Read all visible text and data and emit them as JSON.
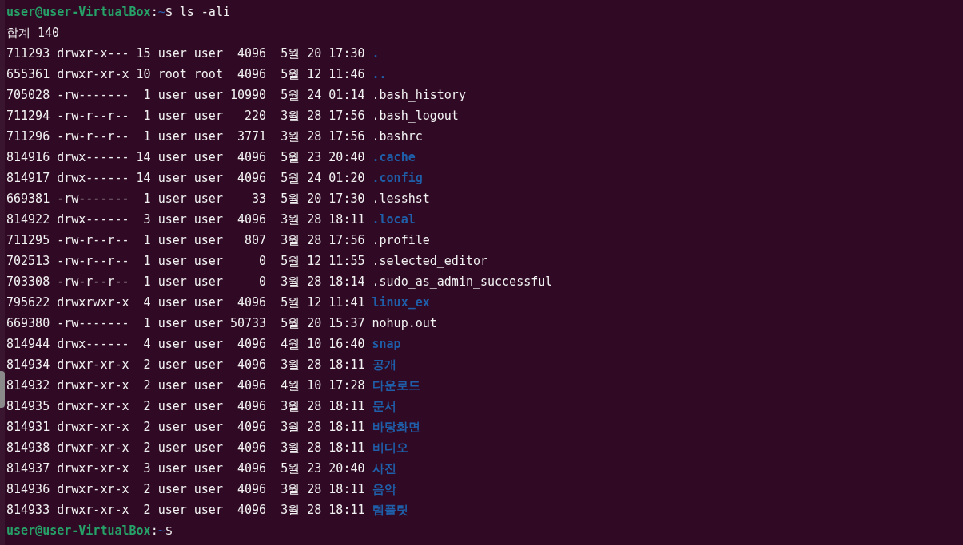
{
  "prompt": {
    "user_host": "user@user-VirtualBox",
    "separator": ":",
    "path": "~",
    "symbol": "$",
    "command": "ls -ali"
  },
  "total": "합계 140",
  "entries": [
    {
      "info": "711293 drwxr-x--- 15 user user  4096  5월 20 17:30",
      "name": ".",
      "kind": "dir"
    },
    {
      "info": "655361 drwxr-xr-x 10 root root  4096  5월 12 11:46",
      "name": "..",
      "kind": "dir"
    },
    {
      "info": "705028 -rw-------  1 user user 10990  5월 24 01:14",
      "name": ".bash_history",
      "kind": "file"
    },
    {
      "info": "711294 -rw-r--r--  1 user user   220  3월 28 17:56",
      "name": ".bash_logout",
      "kind": "file"
    },
    {
      "info": "711296 -rw-r--r--  1 user user  3771  3월 28 17:56",
      "name": ".bashrc",
      "kind": "file"
    },
    {
      "info": "814916 drwx------ 14 user user  4096  5월 23 20:40",
      "name": ".cache",
      "kind": "dir"
    },
    {
      "info": "814917 drwx------ 14 user user  4096  5월 24 01:20",
      "name": ".config",
      "kind": "dir"
    },
    {
      "info": "669381 -rw-------  1 user user    33  5월 20 17:30",
      "name": ".lesshst",
      "kind": "file"
    },
    {
      "info": "814922 drwx------  3 user user  4096  3월 28 18:11",
      "name": ".local",
      "kind": "dir"
    },
    {
      "info": "711295 -rw-r--r--  1 user user   807  3월 28 17:56",
      "name": ".profile",
      "kind": "file"
    },
    {
      "info": "702513 -rw-r--r--  1 user user     0  5월 12 11:55",
      "name": ".selected_editor",
      "kind": "file"
    },
    {
      "info": "703308 -rw-r--r--  1 user user     0  3월 28 18:14",
      "name": ".sudo_as_admin_successful",
      "kind": "file"
    },
    {
      "info": "795622 drwxrwxr-x  4 user user  4096  5월 12 11:41",
      "name": "linux_ex",
      "kind": "dir"
    },
    {
      "info": "669380 -rw-------  1 user user 50733  5월 20 15:37",
      "name": "nohup.out",
      "kind": "file"
    },
    {
      "info": "814944 drwx------  4 user user  4096  4월 10 16:40",
      "name": "snap",
      "kind": "dir"
    },
    {
      "info": "814934 drwxr-xr-x  2 user user  4096  3월 28 18:11",
      "name": "공개",
      "kind": "dir"
    },
    {
      "info": "814932 drwxr-xr-x  2 user user  4096  4월 10 17:28",
      "name": "다운로드",
      "kind": "dir"
    },
    {
      "info": "814935 drwxr-xr-x  2 user user  4096  3월 28 18:11",
      "name": "문서",
      "kind": "dir"
    },
    {
      "info": "814931 drwxr-xr-x  2 user user  4096  3월 28 18:11",
      "name": "바탕화면",
      "kind": "dir"
    },
    {
      "info": "814938 drwxr-xr-x  2 user user  4096  3월 28 18:11",
      "name": "비디오",
      "kind": "dir"
    },
    {
      "info": "814937 drwxr-xr-x  3 user user  4096  5월 23 20:40",
      "name": "사진",
      "kind": "dir"
    },
    {
      "info": "814936 drwxr-xr-x  2 user user  4096  3월 28 18:11",
      "name": "음악",
      "kind": "dir"
    },
    {
      "info": "814933 drwxr-xr-x  2 user user  4096  3월 28 18:11",
      "name": "템플릿",
      "kind": "dir"
    }
  ],
  "prompt_end": {
    "user_host": "user@user-VirtualBox",
    "separator": ":",
    "path": "~",
    "symbol": "$"
  }
}
